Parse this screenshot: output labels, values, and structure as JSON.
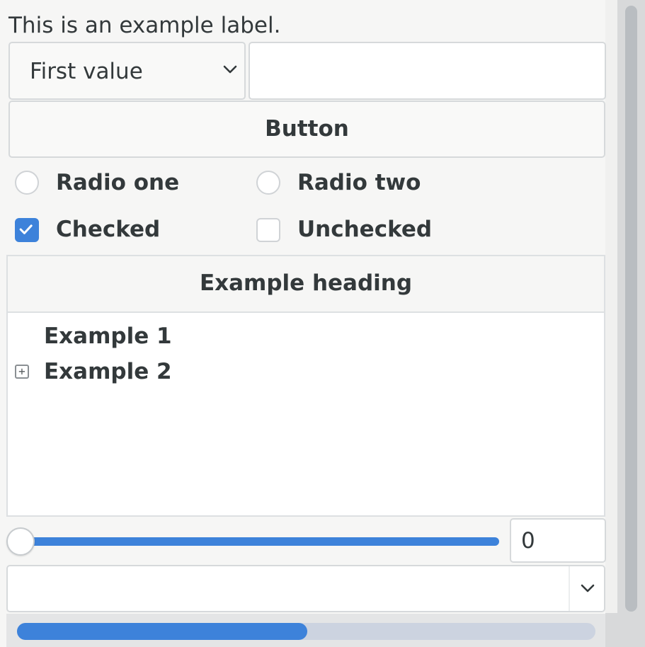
{
  "label": {
    "text": "This is an example label."
  },
  "combo_top": {
    "selected": "First value"
  },
  "entry_top": {
    "value": ""
  },
  "button": {
    "label": "Button"
  },
  "radios": [
    {
      "label": "Radio one",
      "selected": false
    },
    {
      "label": "Radio two",
      "selected": false
    }
  ],
  "checks": [
    {
      "label": "Checked",
      "checked": true
    },
    {
      "label": "Unchecked",
      "checked": false
    }
  ],
  "tree": {
    "heading": "Example heading",
    "rows": [
      {
        "label": "Example 1",
        "expandable": false
      },
      {
        "label": "Example 2",
        "expandable": true,
        "expander_glyph": "+"
      }
    ]
  },
  "slider": {
    "value_fraction": 0.0
  },
  "spinbox": {
    "value": "0"
  },
  "combo_bottom": {
    "selected": ""
  },
  "hscrollbar": {
    "thumb_fraction": 0.5,
    "position_fraction": 0.0
  },
  "colors": {
    "accent": "#3d82da",
    "background": "#f6f6f5",
    "border": "#d6d9db",
    "text": "#33393b"
  },
  "icons": {
    "dropdown": "chevron-down-icon",
    "check": "checkmark-icon",
    "expander": "plus-expander-icon"
  }
}
